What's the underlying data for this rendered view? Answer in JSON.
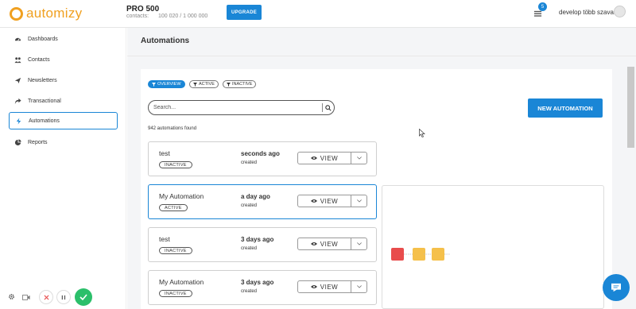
{
  "brand": {
    "name": "automizy",
    "color": "#f0a020"
  },
  "header": {
    "plan_name": "PRO 500",
    "contacts_label": "contacts:",
    "contacts_value": "100 020 / 1 000 000",
    "upgrade_label": "UPGRADE",
    "notification_count": "5",
    "user_name": "develop több szavas"
  },
  "sidebar": {
    "items": [
      {
        "label": "Dashboards",
        "icon": "dashboard-icon",
        "active": false
      },
      {
        "label": "Contacts",
        "icon": "users-icon",
        "active": false
      },
      {
        "label": "Newsletters",
        "icon": "paper-plane-icon",
        "active": false
      },
      {
        "label": "Transactional",
        "icon": "share-arrow-icon",
        "active": false
      },
      {
        "label": "Automations",
        "icon": "bolt-icon",
        "active": true
      },
      {
        "label": "Reports",
        "icon": "pie-chart-icon",
        "active": false
      }
    ]
  },
  "main": {
    "title": "Automations",
    "filters": [
      {
        "label": "OVERVIEW",
        "selected": true
      },
      {
        "label": "ACTIVE",
        "selected": false
      },
      {
        "label": "INACTIVE",
        "selected": false
      }
    ],
    "search": {
      "placeholder": "Search...",
      "value": ""
    },
    "new_button_label": "NEW AUTOMATION",
    "found_text": "942 automations found",
    "view_label": "VIEW",
    "automations": [
      {
        "name": "test",
        "status": "INACTIVE",
        "time": "seconds ago",
        "time_sub": "created",
        "selected": false
      },
      {
        "name": "My Automation",
        "status": "ACTIVE",
        "time": "a day ago",
        "time_sub": "created",
        "selected": true
      },
      {
        "name": "test",
        "status": "INACTIVE",
        "time": "3 days ago",
        "time_sub": "created",
        "selected": false
      },
      {
        "name": "My Automation",
        "status": "INACTIVE",
        "time": "3 days ago",
        "time_sub": "created",
        "selected": false
      }
    ]
  },
  "colors": {
    "accent": "#1a86d6",
    "node_red": "#e84c4c",
    "node_yellow": "#f5c04a",
    "success": "#2bbf6a"
  }
}
